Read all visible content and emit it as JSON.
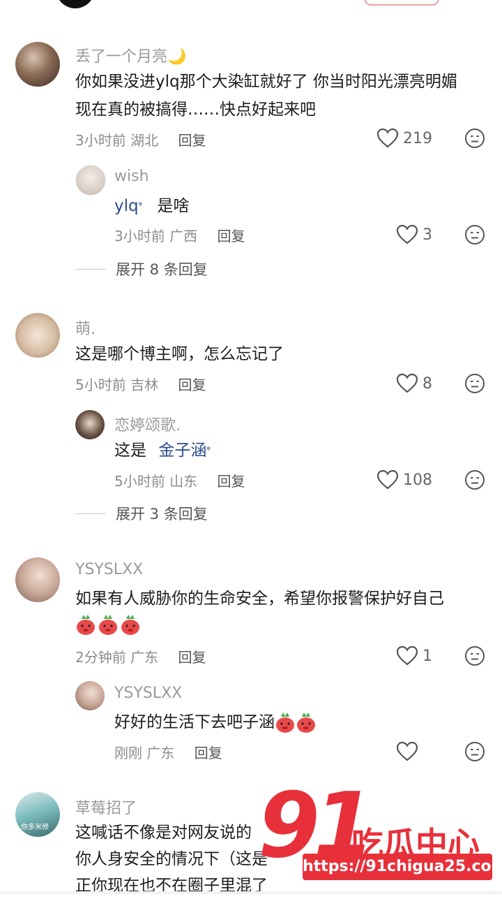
{
  "comments": [
    {
      "username": "丢了一个月亮🌙",
      "lines": [
        "你如果没进ylq那个大染缸就好了 你当时阳光漂亮明媚",
        "现在真的被搞得……快点好起来吧"
      ],
      "time": "3小时前",
      "location": "湖北",
      "reply_label": "回复",
      "likes": "219",
      "reply": {
        "username": "wish",
        "mention": "ylq",
        "text": "是啥",
        "time": "3小时前",
        "location": "广西",
        "reply_label": "回复",
        "likes": "3"
      },
      "expand": "展开 8 条回复"
    },
    {
      "username": "萌.",
      "lines": [
        "这是哪个博主啊，怎么忘记了"
      ],
      "time": "5小时前",
      "location": "吉林",
      "reply_label": "回复",
      "likes": "8",
      "reply": {
        "username": "恋婷颂歌.",
        "prefix": "这是",
        "mention": "金子涵",
        "time": "5小时前",
        "location": "山东",
        "reply_label": "回复",
        "likes": "108"
      },
      "expand": "展开 3 条回复"
    },
    {
      "username": "YSYSLXX",
      "lines": [
        "如果有人威胁你的生命安全，希望你报警保护好自己"
      ],
      "time": "2分钟前",
      "location": "广东",
      "reply_label": "回复",
      "likes": "1",
      "reply": {
        "username": "YSYSLXX",
        "text": "好好的生活下去吧子涵",
        "time": "刚刚",
        "location": "广东",
        "reply_label": "回复",
        "likes": ""
      }
    },
    {
      "username": "草莓招了",
      "avatar_caption": "你多米修",
      "lines": [
        "这喊话不像是对网友说的",
        "你人身安全的情况下（这是",
        "正你现在也不在圈子里混了"
      ]
    }
  ],
  "watermark": {
    "number": "91",
    "brand": "吃瓜中心",
    "url": "https://91chigua25.com"
  },
  "colors": {
    "accent": "#e8303a",
    "mention": "#2b4b8e",
    "meta": "#8c8c8c"
  }
}
